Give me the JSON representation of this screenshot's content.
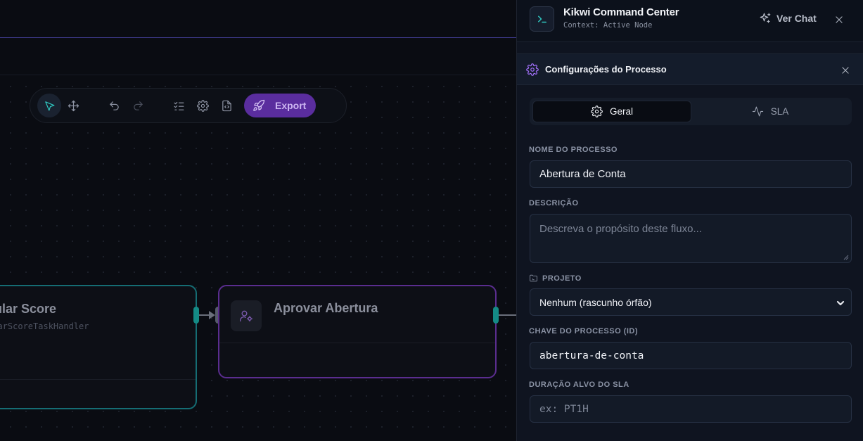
{
  "canvas": {
    "toolbar": {
      "export_label": "Export",
      "tools": [
        "select-tool",
        "pan-tool",
        "undo",
        "redo",
        "checklist",
        "settings",
        "code-file"
      ]
    },
    "nodes": [
      {
        "title": "cular Score",
        "subtitle": "olarScoreTaskHandler",
        "accent": "#156d74"
      },
      {
        "title": "Aprovar Abertura",
        "accent": "#5a2d8f",
        "icon": "user-cog-icon"
      }
    ]
  },
  "panel": {
    "app_title": "Kikwi Command Center",
    "app_context": "Context: Active Node",
    "chat_label": "Ver Chat",
    "section_title": "Configurações do Processo",
    "tabs": [
      {
        "label": "Geral",
        "icon": "gear-icon",
        "active": true
      },
      {
        "label": "SLA",
        "icon": "activity-icon",
        "active": false
      }
    ],
    "fields": {
      "name_label": "NOME DO PROCESSO",
      "name_value": "Abertura de Conta",
      "description_label": "DESCRIÇÃO",
      "description_placeholder": "Descreva o propósito deste fluxo...",
      "project_label": "PROJETO",
      "project_value": "Nenhum (rascunho órfão)",
      "key_label": "CHAVE DO PROCESSO (ID)",
      "key_value": "abertura-de-conta",
      "sla_label": "DURAÇÃO ALVO DO SLA",
      "sla_placeholder": "ex: PT1H"
    }
  },
  "colors": {
    "accent_teal": "#2fc7c0",
    "accent_purple": "#9b6cf0",
    "export_bg": "#5a2d9e"
  }
}
